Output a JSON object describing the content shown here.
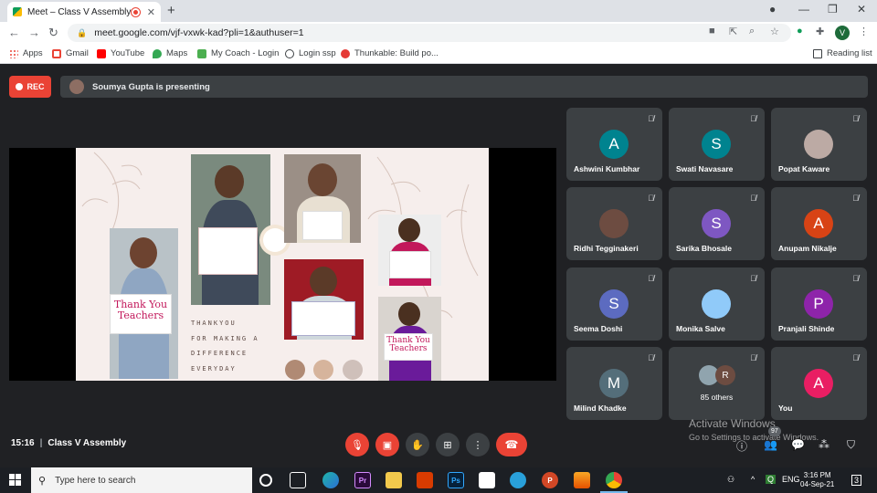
{
  "browser": {
    "tab_title": "Meet – Class V Assembly",
    "tab_close": "✕",
    "new_tab": "+",
    "window_controls": [
      "●",
      "—",
      "❐",
      "✕"
    ],
    "url": "meet.google.com/vjf-vxwk-kad?pli=1&authuser=1",
    "profile_initial": "V"
  },
  "bookmarks": {
    "items": [
      {
        "label": "Apps",
        "color": "#ea4335"
      },
      {
        "label": "Gmail",
        "color": "#ea4335"
      },
      {
        "label": "YouTube",
        "color": "#ff0000"
      },
      {
        "label": "Maps",
        "color": "#34a853"
      },
      {
        "label": "My Coach - Login",
        "color": "#4caf50"
      },
      {
        "label": "Login ssp",
        "color": "#3c4043"
      },
      {
        "label": "Thunkable: Build po...",
        "color": "#e53935"
      }
    ],
    "reading_list": "Reading list"
  },
  "meet": {
    "rec_label": "REC",
    "presenting_text": "Soumya Gupta is presenting",
    "meeting_time": "15:16",
    "meeting_name": "Class V Assembly",
    "participant_count_badge": "97",
    "watermark_line1": "Activate Windows",
    "watermark_line2": "Go to Settings to activate Windows."
  },
  "slide": {
    "card_thank_you_left": "Thank You Teachers",
    "card_thank_you_right": "Thank You Teachers",
    "text_lines": [
      "THANKYOU",
      "FOR MAKING A",
      "DIFFERENCE",
      "EVERYDAY"
    ],
    "swatch_colors": [
      "#b08a74",
      "#d6b49c",
      "#cfc0ba"
    ]
  },
  "participants": [
    {
      "name": "Ashwini Kumbhar",
      "initial": "A",
      "color": "#00838f",
      "photo": false
    },
    {
      "name": "Swati Navasare",
      "initial": "S",
      "color": "#00838f",
      "photo": false
    },
    {
      "name": "Popat Kaware",
      "initial": "",
      "color": "#bcaaa4",
      "photo": true
    },
    {
      "name": "Ridhi Tegginakeri",
      "initial": "",
      "color": "#6d4c41",
      "photo": true
    },
    {
      "name": "Sarika Bhosale",
      "initial": "S",
      "color": "#7e57c2",
      "photo": false
    },
    {
      "name": "Anupam Nikalje",
      "initial": "A",
      "color": "#d84315",
      "photo": false
    },
    {
      "name": "Seema Doshi",
      "initial": "S",
      "color": "#5c6bc0",
      "photo": false
    },
    {
      "name": "Monika Salve",
      "initial": "",
      "color": "#90caf9",
      "photo": true
    },
    {
      "name": "Pranjali Shinde",
      "initial": "P",
      "color": "#8e24aa",
      "photo": false
    },
    {
      "name": "Milind Khadke",
      "initial": "M",
      "color": "#546e7a",
      "photo": false
    },
    {
      "name": "85 others",
      "initial": "R",
      "color": "#6d4c41",
      "photo": false
    },
    {
      "name": "You",
      "initial": "A",
      "color": "#e91e63",
      "photo": false
    }
  ],
  "taskbar": {
    "search_placeholder": "Type here to search",
    "language": "ENG",
    "time": "3:16 PM",
    "date": "04-Sep-21",
    "notification_count": "3"
  }
}
